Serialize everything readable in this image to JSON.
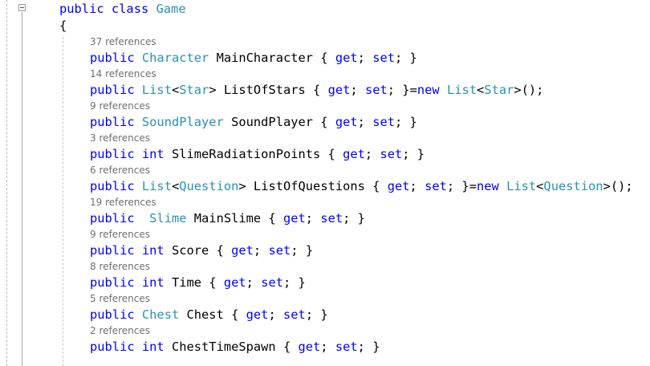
{
  "colors": {
    "keyword": "#0000ff",
    "type": "#2b91af",
    "plain": "#000000",
    "codelens": "#6f6f6f"
  },
  "icons": {
    "collapse": "collapse-minus-icon"
  },
  "code": {
    "class_decl": {
      "kw_public": "public",
      "kw_class": "class",
      "name": "Game"
    },
    "open_brace": "{",
    "members": [
      {
        "refs": "37 references",
        "tokens": [
          "public",
          " ",
          "Character",
          " MainCharacter { ",
          "get",
          "; ",
          "set",
          "; }"
        ]
      },
      {
        "refs": "14 references",
        "tokens": [
          "public",
          " ",
          "List",
          "<",
          "Star",
          "> ListOfStars { ",
          "get",
          "; ",
          "set",
          "; }=",
          "new",
          " ",
          "List",
          "<",
          "Star",
          ">();"
        ]
      },
      {
        "refs": "9 references",
        "tokens": [
          "public",
          " ",
          "SoundPlayer",
          " SoundPlayer { ",
          "get",
          "; ",
          "set",
          "; }"
        ]
      },
      {
        "refs": "3 references",
        "tokens": [
          "public",
          " ",
          "int",
          " SlimeRadiationPoints { ",
          "get",
          "; ",
          "set",
          "; }"
        ]
      },
      {
        "refs": "6 references",
        "tokens": [
          "public",
          " ",
          "List",
          "<",
          "Question",
          "> ListOfQuestions { ",
          "get",
          "; ",
          "set",
          "; }=",
          "new",
          " ",
          "List",
          "<",
          "Question",
          ">();"
        ]
      },
      {
        "refs": "19 references",
        "tokens": [
          "public",
          "  ",
          "Slime",
          " MainSlime { ",
          "get",
          "; ",
          "set",
          "; }"
        ]
      },
      {
        "refs": "9 references",
        "tokens": [
          "public",
          " ",
          "int",
          " Score { ",
          "get",
          "; ",
          "set",
          "; }"
        ]
      },
      {
        "refs": "8 references",
        "tokens": [
          "public",
          " ",
          "int",
          " Time { ",
          "get",
          "; ",
          "set",
          "; }"
        ]
      },
      {
        "refs": "5 references",
        "tokens": [
          "public",
          " ",
          "Chest",
          " Chest { ",
          "get",
          "; ",
          "set",
          "; }"
        ]
      },
      {
        "refs": "2 references",
        "tokens": [
          "public",
          " ",
          "int",
          " ChestTimeSpawn { ",
          "get",
          "; ",
          "set",
          "; }"
        ]
      }
    ]
  }
}
